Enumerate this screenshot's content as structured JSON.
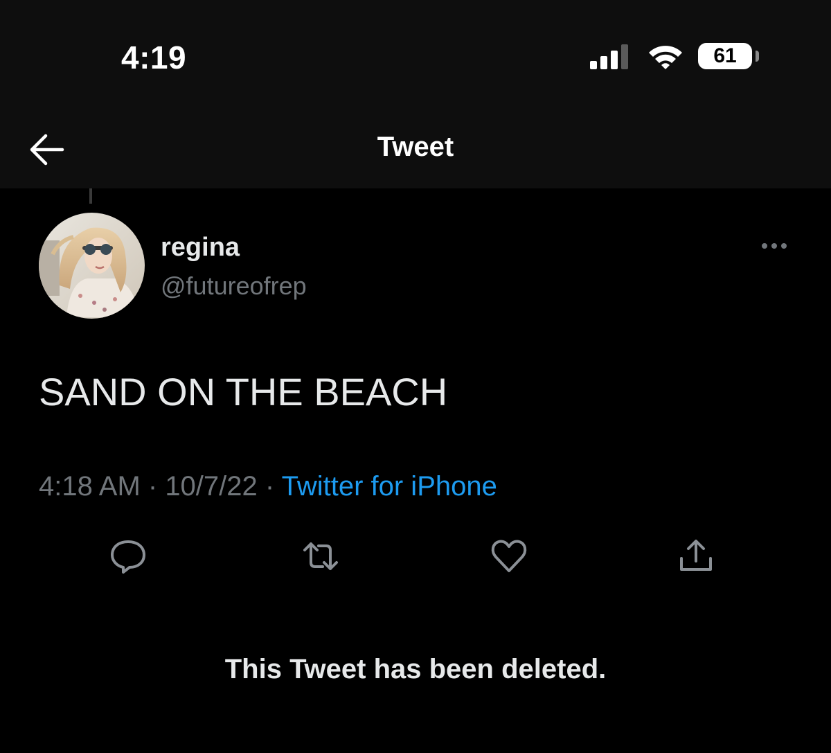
{
  "status_bar": {
    "time": "4:19",
    "battery_level": "61",
    "signal_bars_filled": 3,
    "signal_bars_total": 4,
    "icons": [
      "cellular-signal-icon",
      "wifi-icon",
      "battery-icon"
    ]
  },
  "nav": {
    "back_icon": "arrow-left-icon",
    "title": "Tweet"
  },
  "tweet": {
    "author": {
      "display_name": "regina",
      "handle": "@futureofrep"
    },
    "more_icon": "more-horizontal-icon",
    "text": "SAND ON THE BEACH",
    "time": "4:18 AM",
    "separator": " · ",
    "date": "10/7/22",
    "source": "Twitter for iPhone",
    "actions": {
      "reply_icon": "reply-bubble-icon",
      "retweet_icon": "retweet-icon",
      "like_icon": "heart-icon",
      "share_icon": "share-upload-icon"
    }
  },
  "deleted_notice": "This Tweet has been deleted.",
  "colors": {
    "background": "#000000",
    "header_background": "#0e0e0e",
    "primary_text": "#e7e9ea",
    "secondary_text": "#71767b",
    "link": "#1d9bf0"
  }
}
